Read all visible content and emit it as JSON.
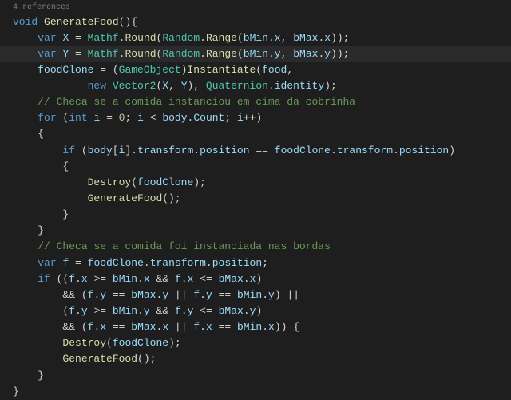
{
  "references": "4 references",
  "code": {
    "l1": {
      "p1": "void",
      "p2": " ",
      "p3": "GenerateFood",
      "p4": "(){"
    },
    "l2": {
      "p1": "    ",
      "p2": "var",
      "p3": " ",
      "p4": "X",
      "p5": " = ",
      "p6": "Mathf",
      "p7": ".",
      "p8": "Round",
      "p9": "(",
      "p10": "Random",
      "p11": ".",
      "p12": "Range",
      "p13": "(",
      "p14": "bMin",
      "p15": ".",
      "p16": "x",
      "p17": ", ",
      "p18": "bMax",
      "p19": ".",
      "p20": "x",
      "p21": "));"
    },
    "l3": {
      "p1": "    ",
      "p2": "var",
      "p3": " ",
      "p4": "Y",
      "p5": " = ",
      "p6": "Mathf",
      "p7": ".",
      "p8": "Round",
      "p9": "(",
      "p10": "Random",
      "p11": ".",
      "p12": "Range",
      "p13": "(",
      "p14": "bMin",
      "p15": ".",
      "p16": "y",
      "p17": ", ",
      "p18": "bMax",
      "p19": ".",
      "p20": "y",
      "p21": "));"
    },
    "l4": {
      "p1": "    ",
      "p2": "foodClone",
      "p3": " = (",
      "p4": "GameObject",
      "p5": ")",
      "p6": "Instantiate",
      "p7": "(",
      "p8": "food",
      "p9": ","
    },
    "l5": {
      "p1": "            ",
      "p2": "new",
      "p3": " ",
      "p4": "Vector2",
      "p5": "(",
      "p6": "X",
      "p7": ", ",
      "p8": "Y",
      "p9": "), ",
      "p10": "Quaternion",
      "p11": ".",
      "p12": "identity",
      "p13": ");"
    },
    "l6": {
      "p1": "    ",
      "p2": "// Checa se a comida instanciou em cima da cobrinha"
    },
    "l7": {
      "p1": "    ",
      "p2": "for",
      "p3": " (",
      "p4": "int",
      "p5": " ",
      "p6": "i",
      "p7": " = ",
      "p8": "0",
      "p9": "; ",
      "p10": "i",
      "p11": " < ",
      "p12": "body",
      "p13": ".",
      "p14": "Count",
      "p15": "; ",
      "p16": "i",
      "p17": "++)"
    },
    "l8": {
      "p1": "    {"
    },
    "l9": {
      "p1": "        ",
      "p2": "if",
      "p3": " (",
      "p4": "body",
      "p5": "[",
      "p6": "i",
      "p7": "].",
      "p8": "transform",
      "p9": ".",
      "p10": "position",
      "p11": " == ",
      "p12": "foodClone",
      "p13": ".",
      "p14": "transform",
      "p15": ".",
      "p16": "position",
      "p17": ")"
    },
    "l10": {
      "p1": "        {"
    },
    "l11": {
      "p1": "            ",
      "p2": "Destroy",
      "p3": "(",
      "p4": "foodClone",
      "p5": ");"
    },
    "l12": {
      "p1": "            ",
      "p2": "GenerateFood",
      "p3": "();"
    },
    "l13": {
      "p1": "        }"
    },
    "l14": {
      "p1": "    }"
    },
    "l15": {
      "p1": "    ",
      "p2": "// Checa se a comida foi instanciada nas bordas"
    },
    "l16": {
      "p1": "    ",
      "p2": "var",
      "p3": " ",
      "p4": "f",
      "p5": " = ",
      "p6": "foodClone",
      "p7": ".",
      "p8": "transform",
      "p9": ".",
      "p10": "position",
      "p11": ";"
    },
    "l17": {
      "p1": "    ",
      "p2": "if",
      "p3": " ((",
      "p4": "f",
      "p5": ".",
      "p6": "x",
      "p7": " >= ",
      "p8": "bMin",
      "p9": ".",
      "p10": "x",
      "p11": " && ",
      "p12": "f",
      "p13": ".",
      "p14": "x",
      "p15": " <= ",
      "p16": "bMax",
      "p17": ".",
      "p18": "x",
      "p19": ")"
    },
    "l18": {
      "p1": "        && (",
      "p2": "f",
      "p3": ".",
      "p4": "y",
      "p5": " == ",
      "p6": "bMax",
      "p7": ".",
      "p8": "y",
      "p9": " || ",
      "p10": "f",
      "p11": ".",
      "p12": "y",
      "p13": " == ",
      "p14": "bMin",
      "p15": ".",
      "p16": "y",
      "p17": ") ||"
    },
    "l19": {
      "p1": "        (",
      "p2": "f",
      "p3": ".",
      "p4": "y",
      "p5": " >= ",
      "p6": "bMin",
      "p7": ".",
      "p8": "y",
      "p9": " && ",
      "p10": "f",
      "p11": ".",
      "p12": "y",
      "p13": " <= ",
      "p14": "bMax",
      "p15": ".",
      "p16": "y",
      "p17": ")"
    },
    "l20": {
      "p1": "        && (",
      "p2": "f",
      "p3": ".",
      "p4": "x",
      "p5": " == ",
      "p6": "bMax",
      "p7": ".",
      "p8": "x",
      "p9": " || ",
      "p10": "f",
      "p11": ".",
      "p12": "x",
      "p13": " == ",
      "p14": "bMin",
      "p15": ".",
      "p16": "x",
      "p17": ")) {"
    },
    "l21": {
      "p1": "        ",
      "p2": "Destroy",
      "p3": "(",
      "p4": "foodClone",
      "p5": ");"
    },
    "l22": {
      "p1": "        ",
      "p2": "GenerateFood",
      "p3": "();"
    },
    "l23": {
      "p1": "    }"
    },
    "l24": {
      "p1": "}"
    }
  }
}
